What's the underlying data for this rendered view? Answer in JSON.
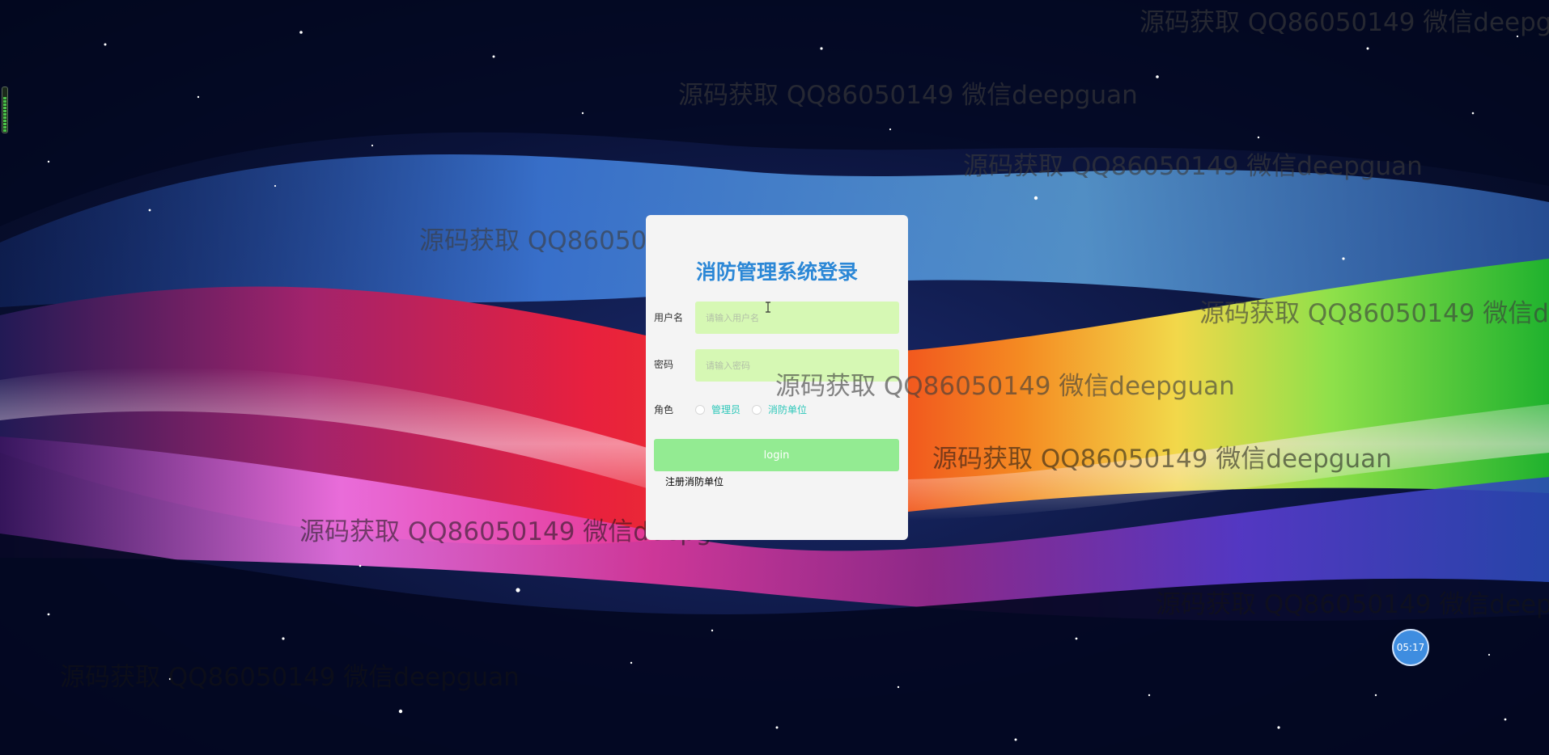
{
  "watermark": {
    "text": "源码获取 QQ86050149 微信deepguan"
  },
  "login": {
    "title": "消防管理系统登录",
    "username_label": "用户名",
    "username_placeholder": "请输入用户名",
    "password_label": "密码",
    "password_placeholder": "请输入密码",
    "role_label": "角色",
    "roles": [
      "管理员",
      "消防单位"
    ],
    "submit_label": "login",
    "register_label": "注册消防单位"
  },
  "clock": {
    "time": "05:17"
  },
  "audio_level": 0.8,
  "colors": {
    "title": "#2b87d6",
    "input_bg": "#d6f8b4",
    "button_bg": "#93eb92",
    "role_text": "#2cc7b9",
    "card_bg": "#f4f4f4"
  }
}
